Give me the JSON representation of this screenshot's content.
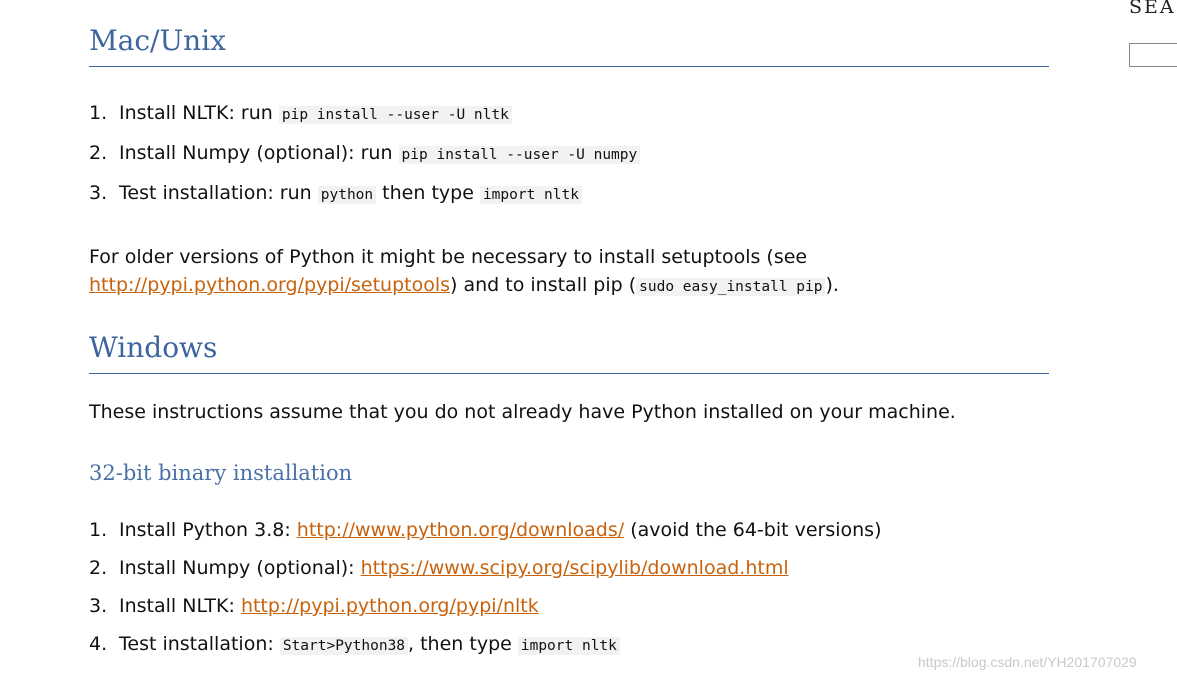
{
  "sidebar": {
    "search_label": "SEA",
    "search_value": ""
  },
  "mac": {
    "heading": "Mac/Unix",
    "steps": [
      {
        "num": "1.",
        "text": "Install NLTK: run ",
        "code": "pip install --user -U nltk"
      },
      {
        "num": "2.",
        "text": "Install Numpy (optional): run ",
        "code": "pip install --user -U numpy"
      },
      {
        "num": "3.",
        "text": "Test installation: run ",
        "code": "python",
        "text2": " then type ",
        "code2": "import nltk"
      }
    ],
    "note": {
      "pre": "For older versions of Python it might be necessary to install setuptools (see",
      "link": "http://pypi.python.org/pypi/setuptools",
      "mid": ") and to install pip (",
      "code": "sudo easy_install pip",
      "post": ")."
    }
  },
  "windows": {
    "heading": "Windows",
    "intro": "These instructions assume that you do not already have Python installed on your machine.",
    "subheading": "32-bit binary installation",
    "steps": [
      {
        "num": "1.",
        "text": "Install Python 3.8: ",
        "link": "http://www.python.org/downloads/",
        "after": " (avoid the 64-bit versions)"
      },
      {
        "num": "2.",
        "text": "Install Numpy (optional): ",
        "link": "https://www.scipy.org/scipylib/download.html"
      },
      {
        "num": "3.",
        "text": "Install NLTK: ",
        "link": "http://pypi.python.org/pypi/nltk"
      },
      {
        "num": "4.",
        "text": "Test installation: ",
        "code": "Start>Python38",
        "text2": ", then type ",
        "code2": "import nltk"
      }
    ]
  },
  "watermark": "https://blog.csdn.net/YH201707029",
  "colors": {
    "heading": "#3d66a0",
    "link": "#c8620d",
    "code_bg": "#f2f2f2"
  }
}
